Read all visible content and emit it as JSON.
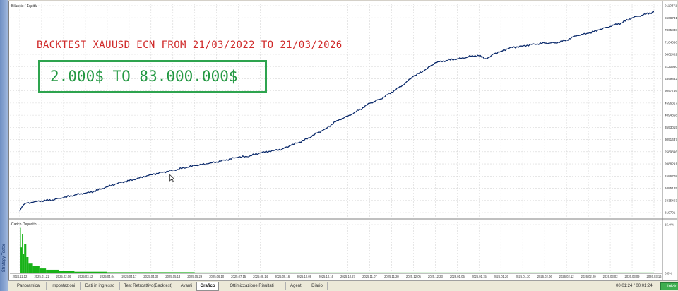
{
  "window": {
    "side_label": "Strategy Tester",
    "balance_legend": "Bilancio / Equità",
    "deposit_legend": "Carico Deposito"
  },
  "overlay": {
    "title": "BACKTEST XAUUSD ECN FROM 21/03/2022 TO 21/03/2026",
    "result": "2.000$ TO 83.000.000$",
    "title_color": "#d02a2a",
    "box_color": "#2ea44f"
  },
  "chart_data": [
    {
      "type": "line",
      "title": "",
      "legend": "Bilancio / Equità",
      "y_tick_labels": [
        "91103716",
        "86087315",
        "78658382",
        "71040669",
        "66024820",
        "61209504",
        "53998326",
        "50977460",
        "45963170",
        "40948583",
        "35930155",
        "30914375",
        "25898963",
        "20882917",
        "15867081",
        "10851253",
        "5835463",
        "819701"
      ],
      "x_tick_labels": [
        "2024.11.12",
        "2025.01.21",
        "2025.02.06",
        "2025.03.12",
        "2025.04.04",
        "2025.04.17",
        "2025.04.30",
        "2025.05.13",
        "2025.05.29",
        "2025.06.10",
        "2025.07.15",
        "2025.08.14",
        "2025.09.16",
        "2025.10.06",
        "2025.10.16",
        "2025.10.27",
        "2025.11.07",
        "2025.11.20",
        "2025.12.05",
        "2025.12.23",
        "2026.01.05",
        "2026.01.15",
        "2026.01.26",
        "2026.01.30",
        "2026.02.06",
        "2026.02.12",
        "2026.02.20",
        "2026.03.02",
        "2026.03.09",
        "2026.03.16"
      ],
      "ylim": [
        0,
        91103716
      ],
      "grid": true,
      "series": [
        {
          "color": "#0b2a6b",
          "x_index": [
            0,
            0.1,
            0.25,
            0.6,
            1,
            1.5,
            2,
            2.8,
            3.2,
            3.9,
            4.5,
            5,
            6,
            6.6,
            7.2,
            8,
            8.6,
            9,
            10,
            10.4,
            11,
            11.6,
            12,
            12.4,
            13,
            13.6,
            14,
            14.5,
            15,
            15.5,
            16,
            16.5,
            17,
            17.5,
            18,
            18.5,
            19,
            19.5,
            20,
            20.3,
            20.7,
            21,
            21.3,
            21.5,
            21.7,
            22,
            22.4,
            23,
            23.4,
            24,
            24.5,
            25,
            25.5,
            26,
            26.5,
            27,
            27.5,
            28,
            28.5,
            29
          ],
          "values": [
            500000,
            2500000,
            4000000,
            4500000,
            5200000,
            5600000,
            6600000,
            8400000,
            8800000,
            11000000,
            13000000,
            14000000,
            16700000,
            17900000,
            19000000,
            20700000,
            21500000,
            22300000,
            24400000,
            24600000,
            26300000,
            27300000,
            28000000,
            29600000,
            31800000,
            35000000,
            37000000,
            40500000,
            42500000,
            45000000,
            48100000,
            50000000,
            53000000,
            56000000,
            60000000,
            62500000,
            66000000,
            67000000,
            67700000,
            68000000,
            69100000,
            69000000,
            67800000,
            68500000,
            70000000,
            71000000,
            72500000,
            73300000,
            74000000,
            74600000,
            74700000,
            76000000,
            78000000,
            78900000,
            80500000,
            82000000,
            83500000,
            85800000,
            87000000,
            88400000
          ]
        }
      ]
    },
    {
      "type": "area",
      "title": "",
      "legend": "Carico Deposito",
      "y_tick_labels": [
        "15.0%",
        "0.0%"
      ],
      "ylim": [
        0,
        15
      ],
      "grid": true,
      "series": [
        {
          "color": "#18b218",
          "x_index": [
            0,
            0.05,
            0.1,
            0.15,
            0.2,
            0.3,
            0.4,
            0.6,
            0.9,
            1.2,
            1.8,
            2.5,
            4,
            8,
            29
          ],
          "values": [
            14,
            8,
            12,
            6,
            9,
            5,
            3,
            2.2,
            1.5,
            1.1,
            0.7,
            0.5,
            0.35,
            0.25,
            0.2
          ]
        }
      ]
    }
  ],
  "tabs": [
    {
      "label": "Panoramica"
    },
    {
      "label": "Impostazioni"
    },
    {
      "label": "Dati in ingresso"
    },
    {
      "label": "Test Retroattivo(Backtest)"
    },
    {
      "label": "Avanti"
    },
    {
      "label": "Grafico"
    },
    {
      "label": "Ottimizzazione Risultati"
    },
    {
      "label": "Agenti"
    },
    {
      "label": "Diario"
    }
  ],
  "active_tab": "Grafico",
  "status": {
    "timer": "00:01:24 / 00:01:24",
    "start_label": "Inizio",
    "start_color": "#3fae4f"
  }
}
